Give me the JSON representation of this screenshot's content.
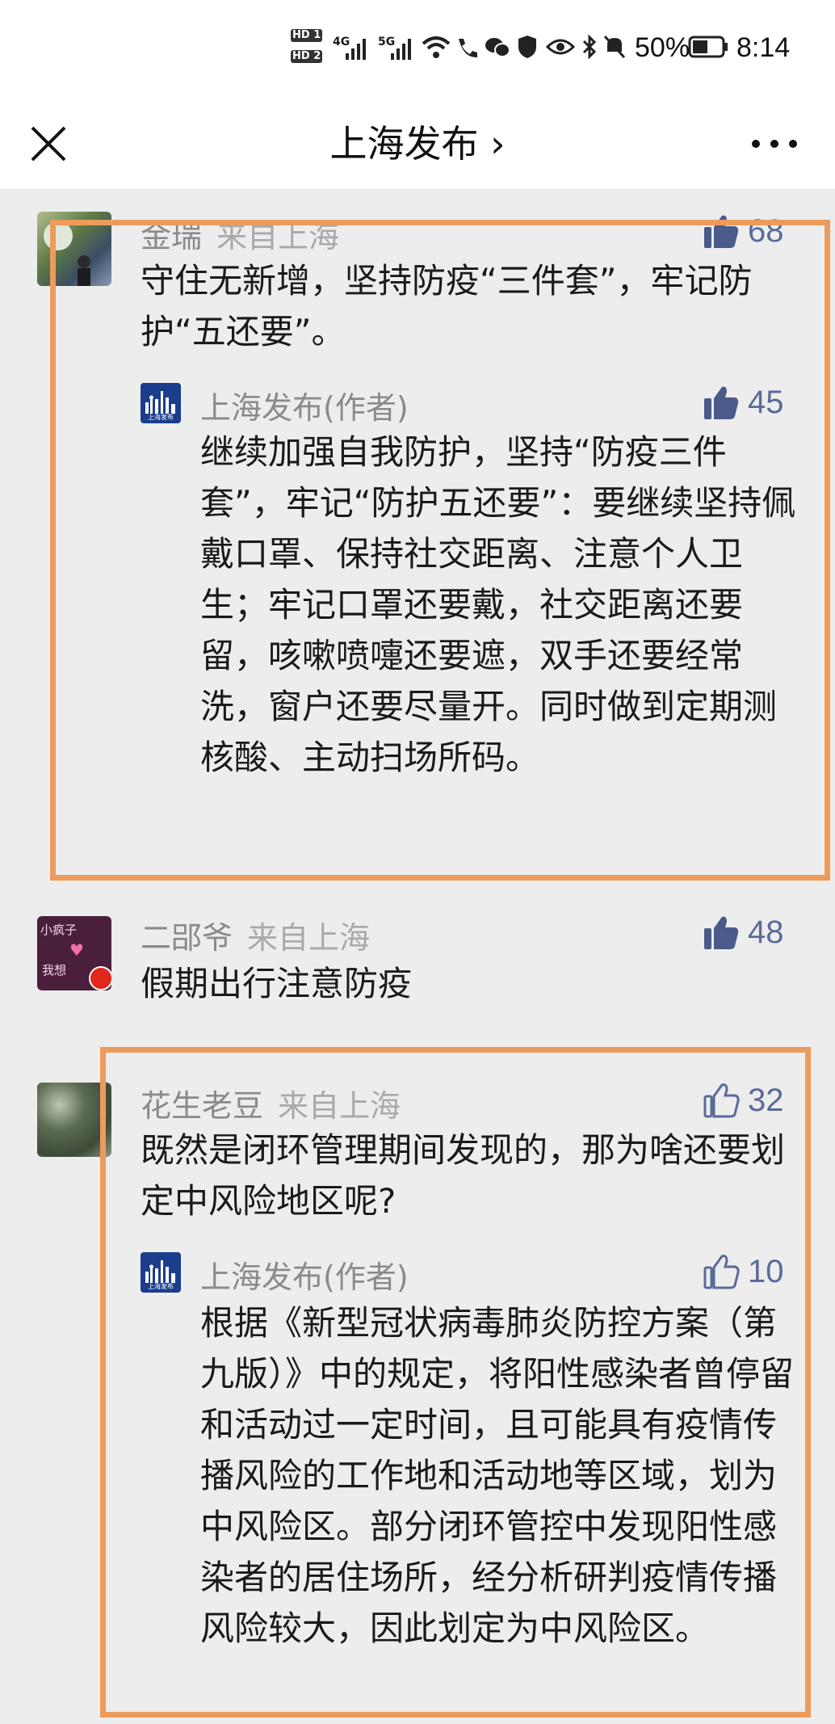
{
  "status_bar": {
    "battery": "50%",
    "time": "8:14",
    "network1": "4G",
    "network2": "5G"
  },
  "nav": {
    "title": "上海发布 ›"
  },
  "comments": [
    {
      "name": "金瑞",
      "location": "来自上海",
      "likes": "68",
      "text": "守住无新增，坚持防疫“三件套”，牢记防护“五还要”。",
      "reply": {
        "name": "上海发布(作者)",
        "likes": "45",
        "text": "继续加强自我防护，坚持“防疫三件套”，牢记“防护五还要”：要继续坚持佩戴口罩、保持社交距离、注意个人卫生；牢记口罩还要戴，社交距离还要留，咳嗽喷嚏还要遮，双手还要经常洗，窗户还要尽量开。同时做到定期测核酸、主动扫场所码。"
      }
    },
    {
      "name": "二郘爷",
      "location": "来自上海",
      "likes": "48",
      "text": "假期出行注意防疫"
    },
    {
      "name": "花生老豆",
      "location": "来自上海",
      "likes": "32",
      "text": "既然是闭环管理期间发现的，那为啥还要划定中风险地区呢?",
      "reply": {
        "name": "上海发布(作者)",
        "likes": "10",
        "text": "根据《新型冠状病毒肺炎防控方案（第九版）》中的规定，将阳性感染者曾停留和活动过一定时间，且可能具有疫情传播风险的工作地和活动地等区域，划为中风险区。部分闭环管控中发现阳性感染者的居住场所，经分析研判疫情传播风险较大，因此划定为中风险区。"
      }
    }
  ],
  "logo_text": "上海发布",
  "avatar2_text": [
    "小疯子",
    "我想"
  ],
  "colors": {
    "highlight": "#ec9b5b",
    "like_filled": "#4a5a8a",
    "like_outline": "#5a6a9a",
    "background": "#ededed"
  }
}
